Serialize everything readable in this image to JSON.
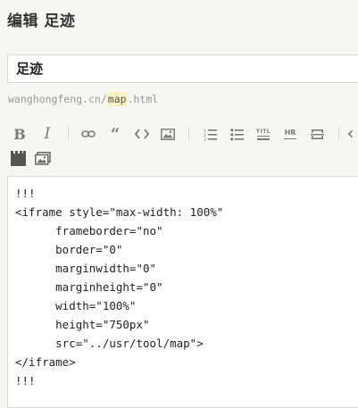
{
  "page": {
    "heading": "编辑 足迹"
  },
  "post": {
    "title": "足迹",
    "url_prefix": "wanghongfeng.cn/",
    "url_slug": "map",
    "url_suffix": ".html"
  },
  "toolbar": {
    "buttons": [
      {
        "name": "bold",
        "glyph": "B"
      },
      {
        "name": "italic",
        "glyph": "I"
      },
      {
        "name": "link",
        "icon": "link-icon"
      },
      {
        "name": "quote",
        "glyph": "“"
      },
      {
        "name": "code",
        "icon": "code-icon"
      },
      {
        "name": "image",
        "icon": "image-icon"
      },
      {
        "name": "ordered-list",
        "icon": "ordered-list-icon"
      },
      {
        "name": "unordered-list",
        "icon": "unordered-list-icon"
      },
      {
        "name": "heading",
        "icon": "heading-icon",
        "glyph": "TITL"
      },
      {
        "name": "hr",
        "icon": "horizontal-rule-icon",
        "glyph": "HR"
      },
      {
        "name": "more",
        "icon": "more-break-icon"
      },
      {
        "name": "undo",
        "icon": "undo-icon"
      },
      {
        "name": "attachment",
        "icon": "file-icon"
      },
      {
        "name": "media",
        "icon": "media-icon"
      }
    ]
  },
  "editor": {
    "lines": [
      "!!!",
      "<iframe style=\"max-width: 100%\"",
      "      frameborder=\"no\"",
      "      border=\"0\"",
      "      marginwidth=\"0\"",
      "      marginheight=\"0\"",
      "      width=\"100%\"",
      "      height=\"750px\"",
      "      src=\"../usr/tool/map\">",
      "</iframe>",
      "!!!"
    ]
  }
}
